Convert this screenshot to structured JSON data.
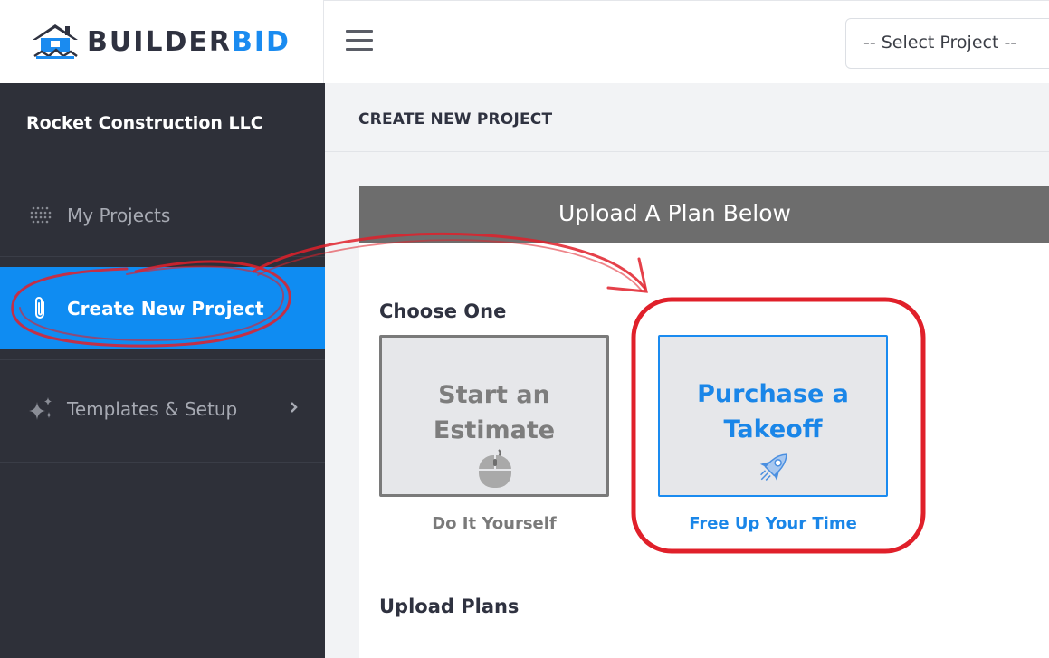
{
  "brand": {
    "name_part1": "BUILDER",
    "name_part2": "BID",
    "accent_color": "#1a8bf0",
    "dark_color": "#2f3240"
  },
  "topbar": {
    "menu_icon": "hamburger-icon",
    "project_select": "-- Select Project --"
  },
  "sidebar": {
    "company": "Rocket Construction LLC",
    "items": [
      {
        "label": "My Projects",
        "icon": "dots-grid-icon"
      },
      {
        "label": "Create New Project",
        "icon": "paperclip-icon",
        "active": true
      },
      {
        "label": "Templates & Setup",
        "icon": "sparkle-icon",
        "has_submenu": true
      }
    ],
    "bg_color": "#2e3039",
    "active_color": "#0f8cf2"
  },
  "main": {
    "title": "CREATE NEW PROJECT",
    "banner": "Upload A Plan Below",
    "choose_label": "Choose One",
    "options": [
      {
        "title": "Start an Estimate",
        "subtitle": "Do It Yourself",
        "icon": "mouse-icon"
      },
      {
        "title": "Purchase a Takeoff",
        "subtitle": "Free Up Your Time",
        "icon": "rocket-icon"
      }
    ],
    "upload_label": "Upload Plans"
  },
  "annotations": {
    "highlight_color": "#e0202a"
  }
}
